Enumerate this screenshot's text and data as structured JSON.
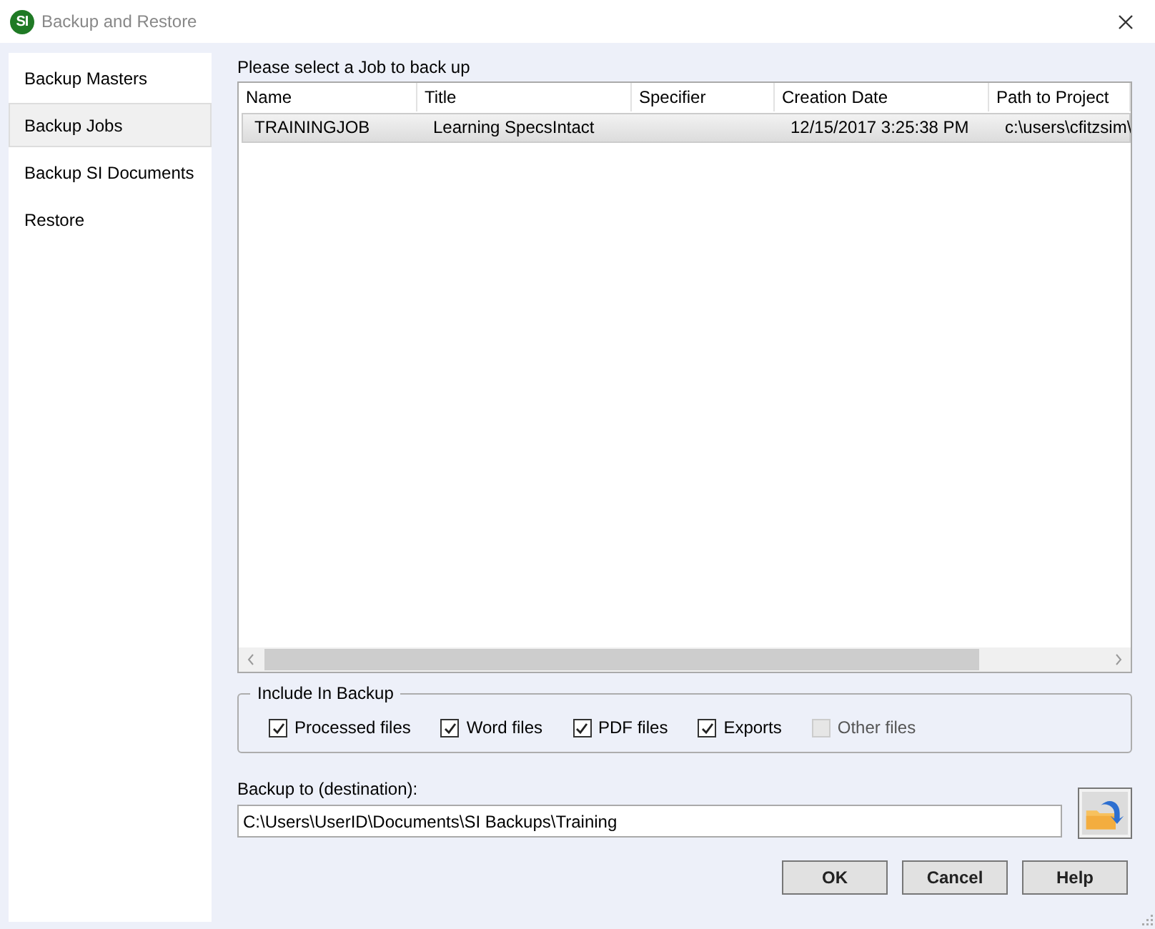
{
  "window": {
    "logo": "SI",
    "title": "Backup and Restore"
  },
  "sidebar": {
    "items": [
      {
        "label": "Backup Masters",
        "selected": false
      },
      {
        "label": "Backup Jobs",
        "selected": true
      },
      {
        "label": "Backup SI Documents",
        "selected": false
      },
      {
        "label": "Restore",
        "selected": false
      }
    ]
  },
  "jobs": {
    "prompt": "Please select a Job to back up",
    "columns": [
      "Name",
      "Title",
      "Specifier",
      "Creation Date",
      "Path to Project"
    ],
    "rows": [
      {
        "cells": [
          "TRAININGJOB",
          "Learning SpecsIntact",
          "",
          "12/15/2017 3:25:38 PM",
          "c:\\users\\cfitzsim\\"
        ],
        "selected": true
      }
    ]
  },
  "include": {
    "legend": "Include In Backup",
    "options": [
      {
        "label": "Processed files",
        "checked": true,
        "disabled": false
      },
      {
        "label": "Word files",
        "checked": true,
        "disabled": false
      },
      {
        "label": "PDF files",
        "checked": true,
        "disabled": false
      },
      {
        "label": "Exports",
        "checked": true,
        "disabled": false
      },
      {
        "label": "Other files",
        "checked": false,
        "disabled": true
      }
    ]
  },
  "destination": {
    "label": "Backup to (destination):",
    "value": "C:\\Users\\UserID\\Documents\\SI Backups\\Training"
  },
  "buttons": [
    "OK",
    "Cancel",
    "Help"
  ]
}
